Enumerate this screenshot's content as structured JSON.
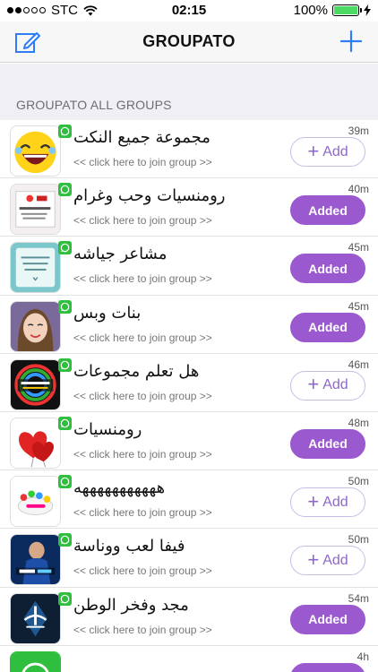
{
  "status": {
    "carrier": "STC",
    "time": "02:15",
    "battery": "100%"
  },
  "nav": {
    "title": "GROUPATO"
  },
  "section": {
    "header": "GROUPATO ALL GROUPS"
  },
  "colors": {
    "accent": "#9b59d0",
    "nav_blue": "#2f7df6",
    "whatsapp_green": "#2fbe3e"
  },
  "groups": [
    {
      "name": "مجموعة جميع النكت",
      "join": "<< click here to join group >>",
      "time": "39m",
      "status": "Add"
    },
    {
      "name": "رومنسيات وحب وغرام",
      "join": "<< click here to join group >>",
      "time": "40m",
      "status": "Added"
    },
    {
      "name": "مشاعر جياشه",
      "join": "<< click here to join group >>",
      "time": "45m",
      "status": "Added"
    },
    {
      "name": "بنات وبس",
      "join": "<< click here to join group >>",
      "time": "45m",
      "status": "Added"
    },
    {
      "name": "هل تعلم مجموعات",
      "join": "<< click here to join group >>",
      "time": "46m",
      "status": "Add"
    },
    {
      "name": "رومنسيات",
      "join": "<< click here to join group >>",
      "time": "48m",
      "status": "Added"
    },
    {
      "name": "هههههههههههه",
      "join": "<< click here to join group >>",
      "time": "50m",
      "status": "Add"
    },
    {
      "name": "فيفا لعب ووناسة",
      "join": "<< click here to join group >>",
      "time": "50m",
      "status": "Add"
    },
    {
      "name": "مجد وفخر الوطن",
      "join": "<< click here to join group >>",
      "time": "54m",
      "status": "Added"
    },
    {
      "name": "",
      "join": "",
      "time": "4h",
      "status": "Added"
    }
  ]
}
